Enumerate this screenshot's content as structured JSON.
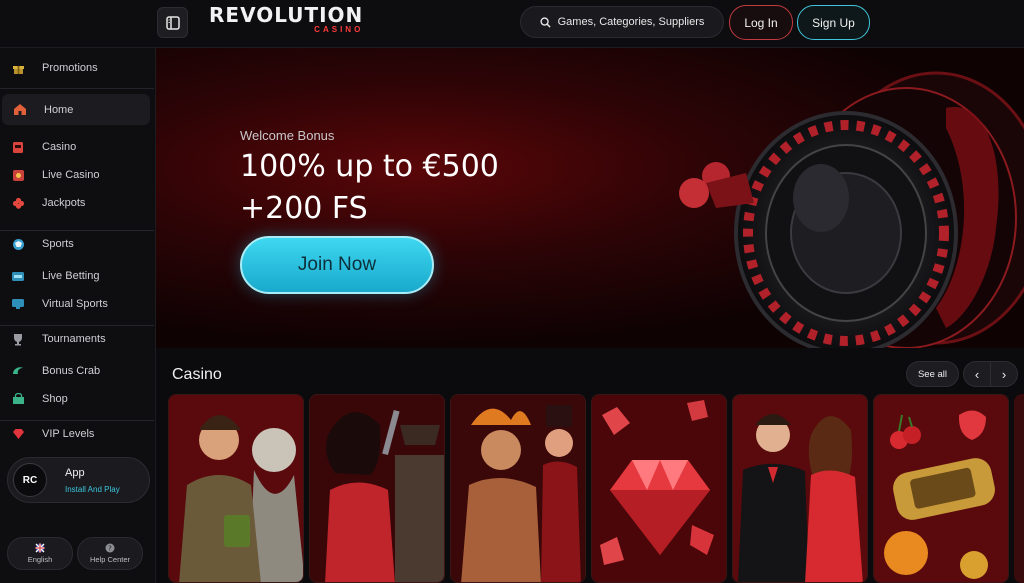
{
  "header": {
    "logo_main": "REVOLUTION",
    "logo_sub": "CASINO",
    "search_placeholder": "Games, Categories, Suppliers",
    "login_label": "Log In",
    "signup_label": "Sign Up"
  },
  "sidebar": {
    "items": [
      {
        "label": "Promotions",
        "icon": "gift-icon"
      },
      {
        "label": "Home",
        "icon": "home-icon"
      },
      {
        "label": "Casino",
        "icon": "slot-machine-icon"
      },
      {
        "label": "Live Casino",
        "icon": "live-casino-icon"
      },
      {
        "label": "Jackpots",
        "icon": "clover-icon"
      },
      {
        "label": "Sports",
        "icon": "ball-icon"
      },
      {
        "label": "Live Betting",
        "icon": "live-betting-icon"
      },
      {
        "label": "Virtual Sports",
        "icon": "monitor-icon"
      },
      {
        "label": "Tournaments",
        "icon": "trophy-icon"
      },
      {
        "label": "Bonus Crab",
        "icon": "crab-icon"
      },
      {
        "label": "Shop",
        "icon": "shop-icon"
      },
      {
        "label": "VIP Levels",
        "icon": "diamond-icon"
      }
    ],
    "app": {
      "logo": "RC",
      "title": "App",
      "subtitle": "Install And Play"
    },
    "language_label": "English",
    "help_label": "Help Center"
  },
  "hero": {
    "subtitle": "Welcome Bonus",
    "title_line1": "100% up to €500",
    "title_line2": "+200 FS",
    "cta_label": "Join Now"
  },
  "casino_section": {
    "title": "Casino",
    "see_all_label": "See all",
    "prev_icon": "chevron-left-icon",
    "next_icon": "chevron-right-icon"
  },
  "colors": {
    "accent_cyan": "#3ec6dc",
    "accent_red": "#c33a40",
    "background": "#0b0b0d"
  }
}
